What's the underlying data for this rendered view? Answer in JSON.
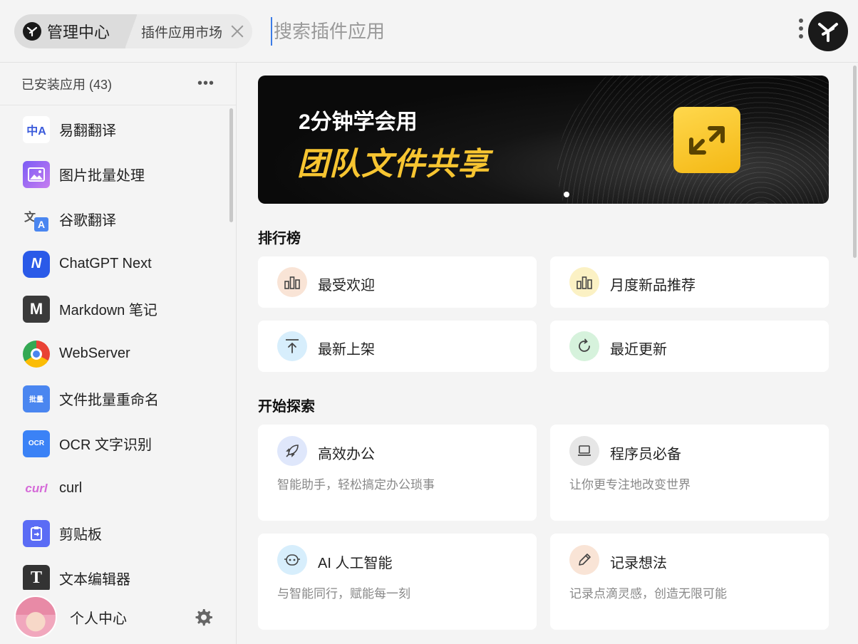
{
  "header": {
    "crumb_main": "管理中心",
    "crumb_sub": "插件应用市场",
    "search_placeholder": "搜索插件应用"
  },
  "sidebar": {
    "title": "已安装应用 (43)",
    "more": "•••",
    "items": [
      {
        "label": "易翻翻译",
        "icon": "translate-zh-icon"
      },
      {
        "label": "图片批量处理",
        "icon": "image-batch-icon"
      },
      {
        "label": "谷歌翻译",
        "icon": "google-translate-icon"
      },
      {
        "label": "ChatGPT Next",
        "icon": "chatgpt-next-icon"
      },
      {
        "label": "Markdown 笔记",
        "icon": "markdown-icon"
      },
      {
        "label": "WebServer",
        "icon": "chrome-icon"
      },
      {
        "label": "文件批量重命名",
        "icon": "rename-icon"
      },
      {
        "label": "OCR 文字识别",
        "icon": "ocr-icon"
      },
      {
        "label": "curl",
        "icon": "curl-icon"
      },
      {
        "label": "剪贴板",
        "icon": "clipboard-icon"
      },
      {
        "label": "文本编辑器",
        "icon": "text-editor-icon"
      }
    ],
    "footer": {
      "user_label": "个人中心"
    }
  },
  "banner": {
    "line1": "2分钟学会用",
    "line2": "团队文件共享"
  },
  "ranking": {
    "title": "排行榜",
    "items": [
      {
        "label": "最受欢迎",
        "icon": "bar-chart-icon",
        "color": "#f9e4d6"
      },
      {
        "label": "月度新品推荐",
        "icon": "bar-chart-icon",
        "color": "#fbf1c4"
      },
      {
        "label": "最新上架",
        "icon": "upload-icon",
        "color": "#d7eefc"
      },
      {
        "label": "最近更新",
        "icon": "refresh-icon",
        "color": "#d6f2dc"
      }
    ]
  },
  "explore": {
    "title": "开始探索",
    "items": [
      {
        "label": "高效办公",
        "desc": "智能助手，轻松搞定办公琐事",
        "icon": "rocket-icon",
        "color": "#dfe7fb"
      },
      {
        "label": "程序员必备",
        "desc": "让你更专注地改变世界",
        "icon": "laptop-icon",
        "color": "#e6e6e6"
      },
      {
        "label": "AI 人工智能",
        "desc": "与智能同行，赋能每一刻",
        "icon": "robot-icon",
        "color": "#d7eefc"
      },
      {
        "label": "记录想法",
        "desc": "记录点滴灵感，创造无限可能",
        "icon": "pencil-icon",
        "color": "#f9e4d6"
      }
    ]
  }
}
